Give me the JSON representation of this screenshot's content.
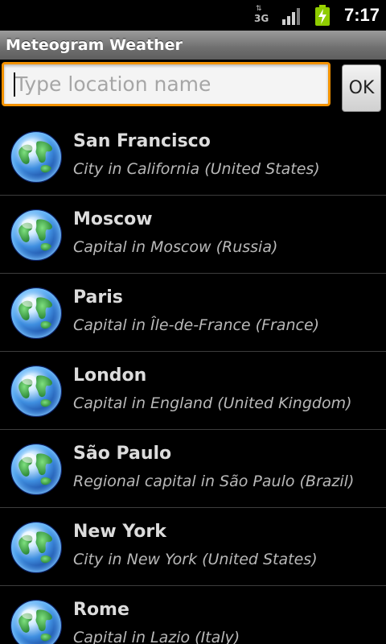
{
  "status_bar": {
    "network_label": "3G",
    "network_arrows": "⇅",
    "time": "7:17",
    "icons": [
      "signal-icon",
      "battery-charging-icon"
    ]
  },
  "app": {
    "title": "Meteogram Weather"
  },
  "search": {
    "placeholder": "Type location name",
    "value": "",
    "ok_label": "OK",
    "focus_color": "#f39200"
  },
  "locations": [
    {
      "name": "San Francisco",
      "description": "City in California (United States)"
    },
    {
      "name": "Moscow",
      "description": "Capital in Moscow (Russia)"
    },
    {
      "name": "Paris",
      "description": "Capital in Île-de-France (France)"
    },
    {
      "name": "London",
      "description": "Capital in England (United Kingdom)"
    },
    {
      "name": "São Paulo",
      "description": "Regional capital in São Paulo (Brazil)"
    },
    {
      "name": "New York",
      "description": "City in New York (United States)"
    },
    {
      "name": "Rome",
      "description": "Capital in Lazio (Italy)"
    }
  ],
  "icons": {
    "location_icon": "globe-icon"
  }
}
